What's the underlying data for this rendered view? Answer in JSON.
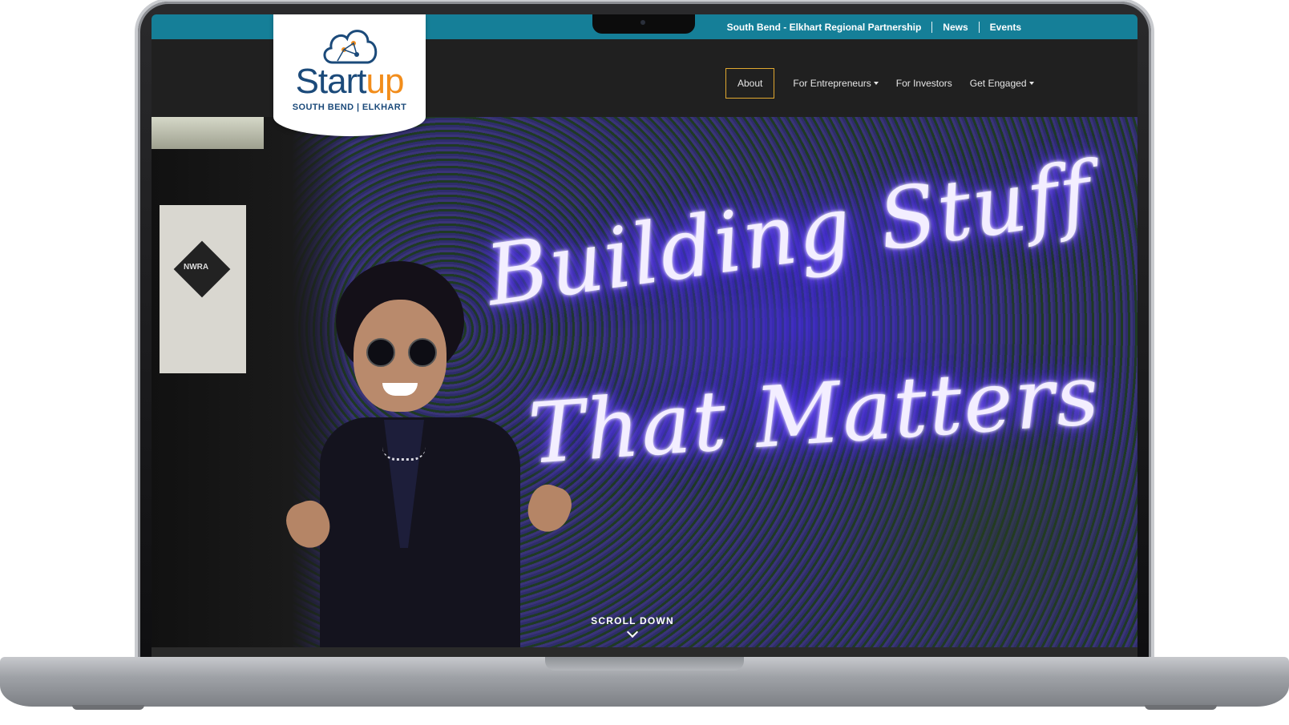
{
  "utility_bar": {
    "links": [
      "South Bend - Elkhart Regional Partnership",
      "News",
      "Events"
    ]
  },
  "logo": {
    "wordmark_start": "Start",
    "wordmark_up": "up",
    "tagline": "SOUTH BEND | ELKHART"
  },
  "nav": {
    "items": [
      {
        "label": "About",
        "active": true,
        "dropdown": false
      },
      {
        "label": "For Entrepreneurs",
        "active": false,
        "dropdown": true
      },
      {
        "label": "For Investors",
        "active": false,
        "dropdown": false
      },
      {
        "label": "Get Engaged",
        "active": false,
        "dropdown": true
      }
    ]
  },
  "hero": {
    "neon_line1": "Building Stuff",
    "neon_line2": "That Matters",
    "banner_text": "NWRA",
    "scroll_label": "SCROLL DOWN"
  },
  "colors": {
    "utility_bar": "#157f98",
    "navbar": "#202020",
    "active_border": "#e0a830",
    "logo_blue": "#1b4a7a",
    "logo_orange": "#f28d1b",
    "neon_glow": "#5a3cff"
  },
  "icons": {
    "cloud": "cloud-network-icon",
    "caret": "caret-down-icon",
    "scroll": "chevron-down-icon"
  }
}
